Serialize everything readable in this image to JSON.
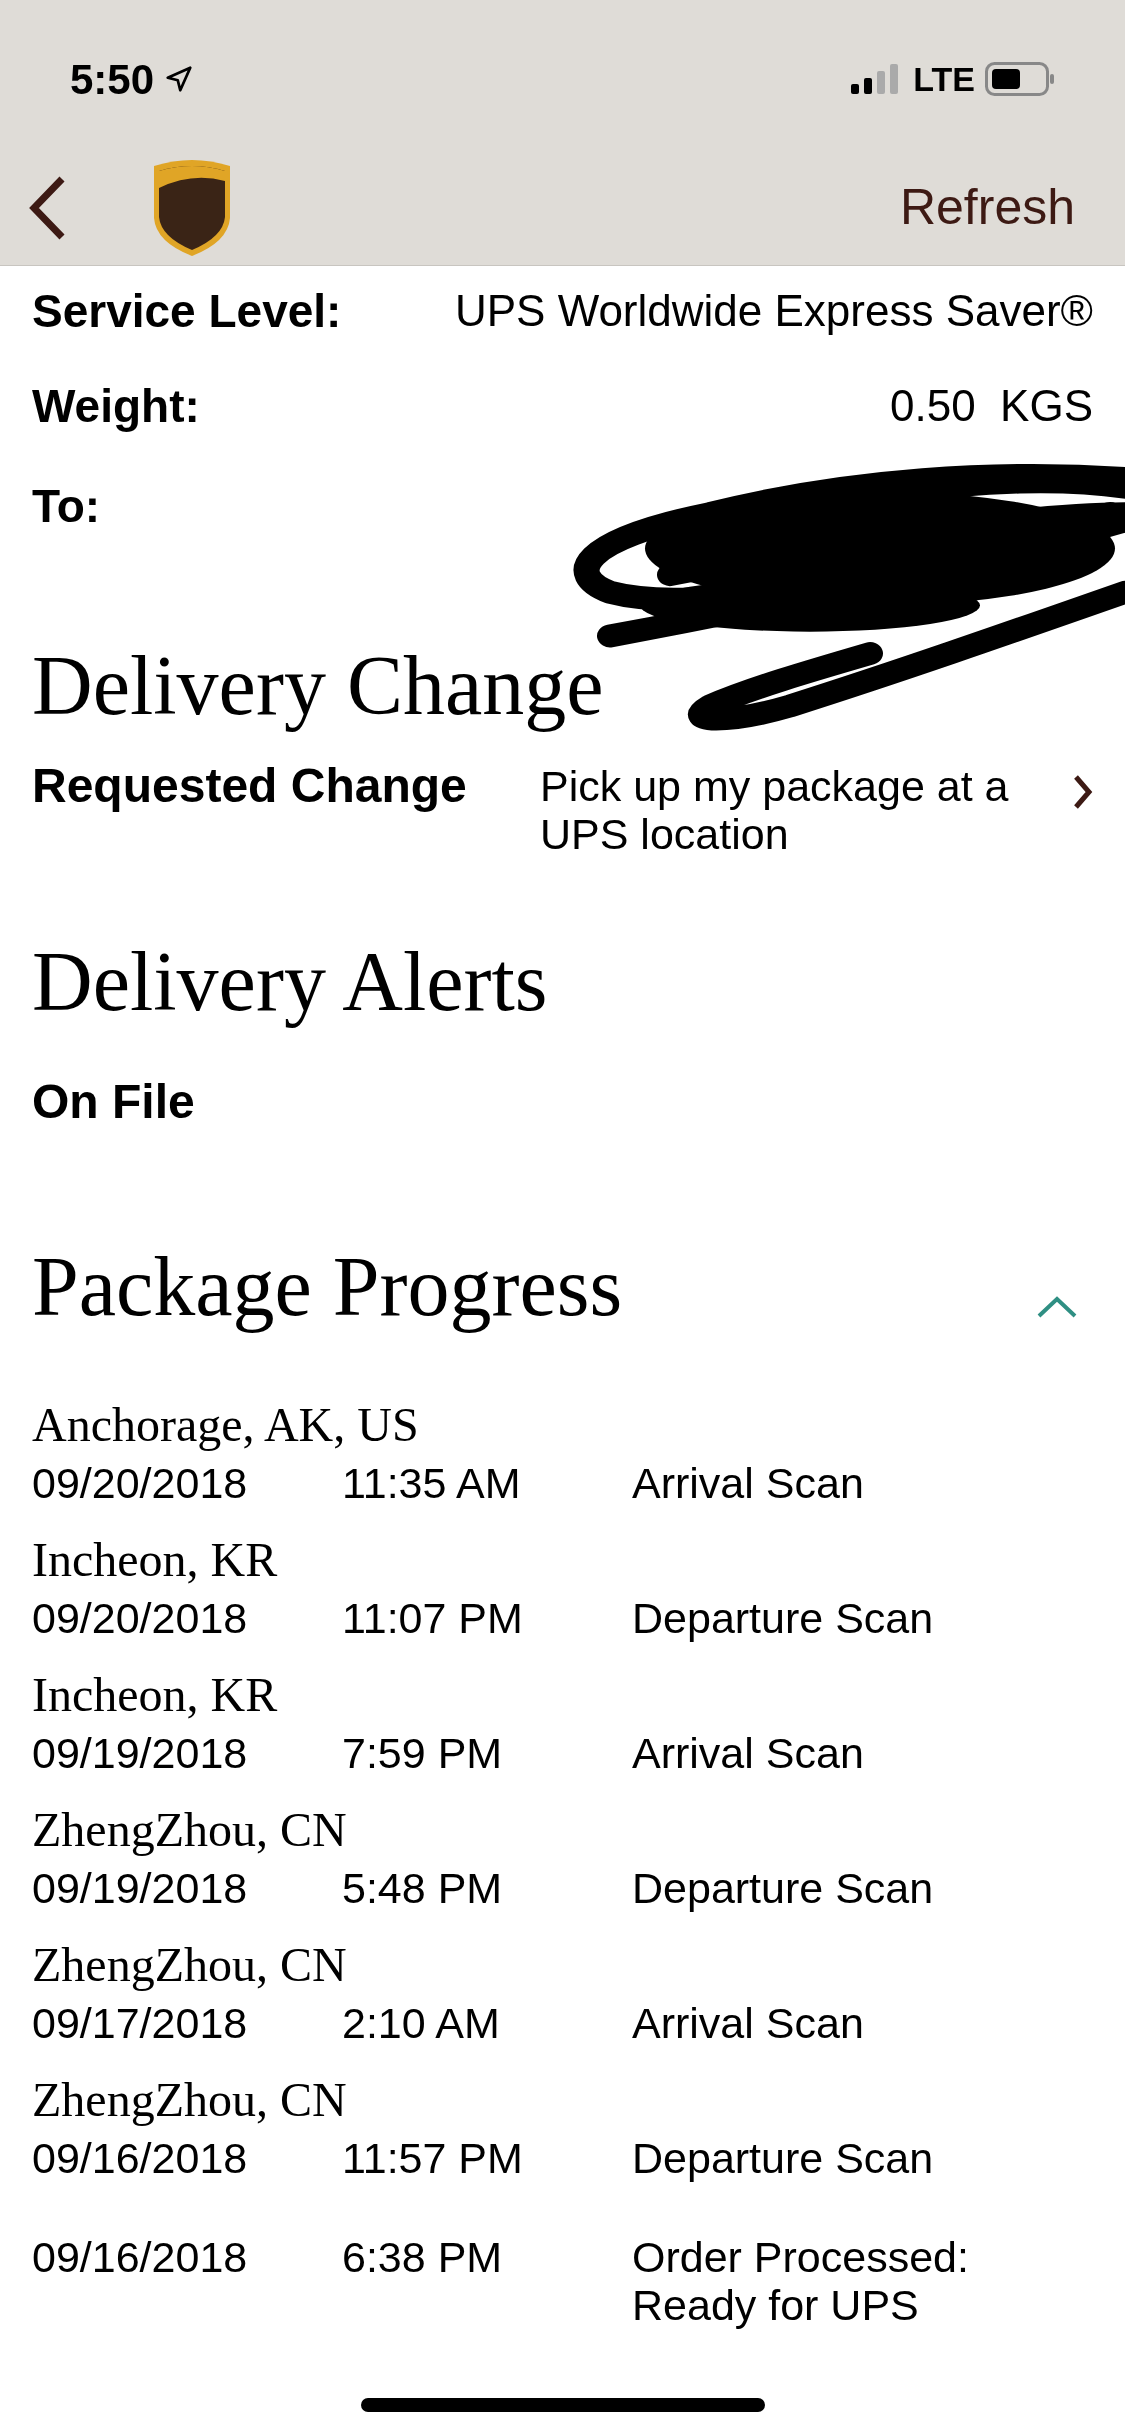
{
  "status_bar": {
    "time": "5:50",
    "network": "LTE"
  },
  "nav": {
    "refresh": "Refresh"
  },
  "details": [
    {
      "label": "Service Level:",
      "value": "UPS Worldwide Express Saver®"
    },
    {
      "label": "Weight:",
      "value": "0.50  KGS"
    },
    {
      "label": "To:"
    }
  ],
  "delivery_change": {
    "heading": "Delivery Change",
    "rows": [
      {
        "label": "Requested Change",
        "value": "Pick up my package at a UPS location"
      }
    ]
  },
  "delivery_alerts": {
    "heading": "Delivery Alerts",
    "status": "On File"
  },
  "package_progress": {
    "heading": "Package Progress",
    "expanded": true,
    "events": [
      {
        "location": "Anchorage, AK, US",
        "date": "09/20/2018",
        "time": "11:35 AM",
        "activity": "Arrival Scan"
      },
      {
        "location": "Incheon, KR",
        "date": "09/20/2018",
        "time": "11:07 PM",
        "activity": "Departure Scan"
      },
      {
        "location": "Incheon, KR",
        "date": "09/19/2018",
        "time": "7:59 PM",
        "activity": "Arrival Scan"
      },
      {
        "location": "ZhengZhou, CN",
        "date": "09/19/2018",
        "time": "5:48 PM",
        "activity": "Departure Scan"
      },
      {
        "location": "ZhengZhou, CN",
        "date": "09/17/2018",
        "time": "2:10 AM",
        "activity": "Arrival Scan"
      },
      {
        "location": "ZhengZhou, CN",
        "date": "09/16/2018",
        "time": "11:57 PM",
        "activity": "Departure Scan"
      },
      {
        "date": "09/16/2018",
        "time": "6:38 PM",
        "activity": "Order Processed: Ready for UPS"
      }
    ]
  }
}
